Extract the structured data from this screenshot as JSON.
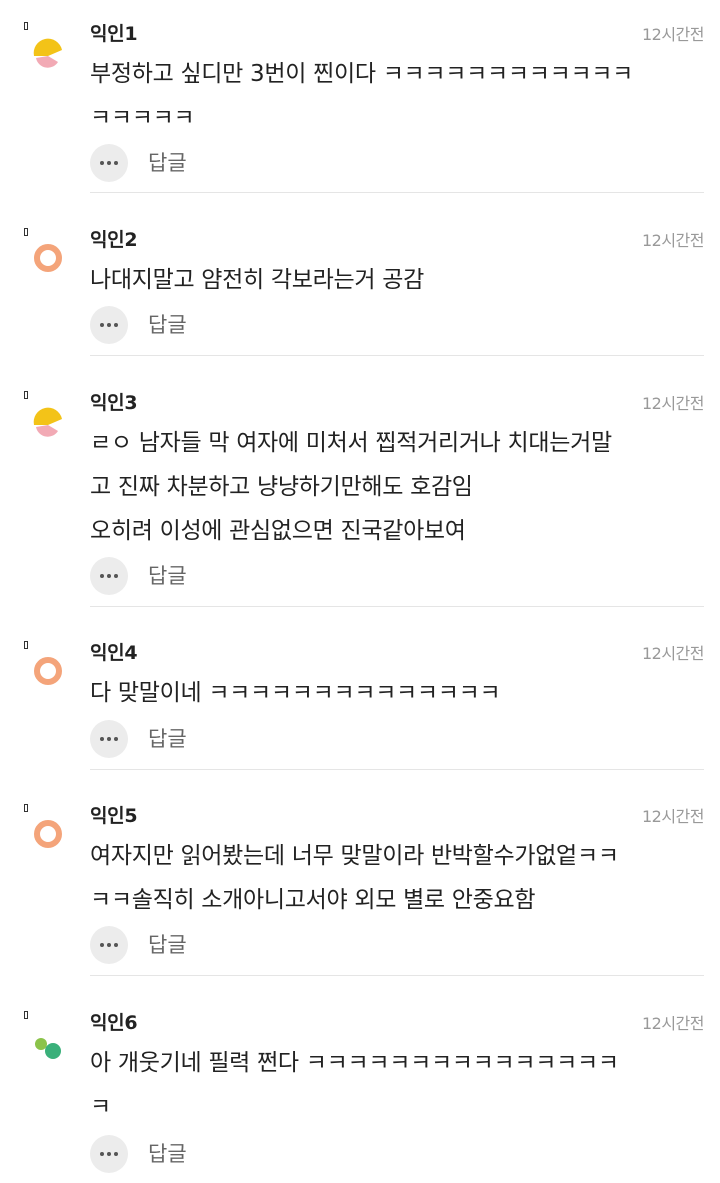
{
  "reply_label": "답글",
  "comments": [
    {
      "nick": "익인1",
      "time": "12시간전",
      "body": "부정하고 싶디만 3번이 찐이다 ㅋㅋㅋㅋㅋㅋㅋㅋㅋㅋㅋㅋ\nㅋㅋㅋㅋㅋ",
      "avatar": "yellow-pink-semicircle"
    },
    {
      "nick": "익인2",
      "time": "12시간전",
      "body": "나대지말고 얌전히 각보라는거 공감",
      "avatar": "orange-ring"
    },
    {
      "nick": "익인3",
      "time": "12시간전",
      "body": "ㄹㅇ 남자들 막 여자에 미처서 찝적거리거나 치대는거말\n고 진짜 차분하고 냥냥하기만해도 호감임\n오히려 이성에 관심없으면 진국같아보여",
      "avatar": "yellow-pink-semicircle"
    },
    {
      "nick": "익인4",
      "time": "12시간전",
      "body": "다 맞말이네 ㅋㅋㅋㅋㅋㅋㅋㅋㅋㅋㅋㅋㅋㅋ",
      "avatar": "orange-ring"
    },
    {
      "nick": "익인5",
      "time": "12시간전",
      "body": "여자지만 읽어봤는데 너무 맞말이라 반박할수가없엍ㅋㅋ\nㅋㅋ솔직히 소개아니고서야 외모 별로 안중요함",
      "avatar": "orange-ring"
    },
    {
      "nick": "익인6",
      "time": "12시간전",
      "body": "아 개웃기네 필력 쩐다 ㅋㅋㅋㅋㅋㅋㅋㅋㅋㅋㅋㅋㅋㅋㅋ\nㅋ",
      "avatar": "green-dots"
    }
  ]
}
